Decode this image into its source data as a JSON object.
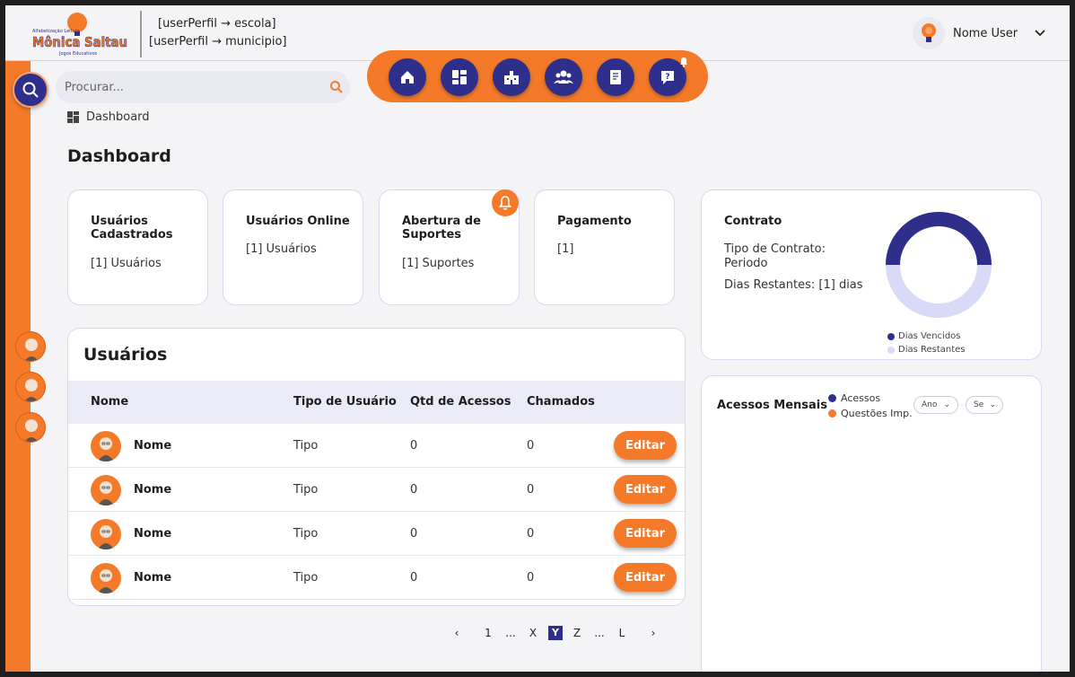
{
  "header": {
    "logo_line1": "Alfabetização Leitura",
    "logo_line2": "Mônica Saltau",
    "logo_line3": "Jogos Educativos",
    "perfil_escola": "[userPerfil → escola]",
    "perfil_municipio": "[userPerfil → municipio]",
    "user_name": "Nome User"
  },
  "search": {
    "placeholder": "Procurar..."
  },
  "nav": {
    "icons": [
      "home-icon",
      "dashboard-icon",
      "school-icon",
      "users-icon",
      "billing-icon",
      "support-icon"
    ]
  },
  "breadcrumb": {
    "label": "Dashboard"
  },
  "page_title": "Dashboard",
  "cards": [
    {
      "title": "Usuários Cadastrados",
      "value": "[1] Usuários"
    },
    {
      "title": "Usuários Online",
      "value": "[1] Usuários"
    },
    {
      "title": "Abertura de Suportes",
      "value": "[1] Suportes"
    },
    {
      "title": "Pagamento",
      "value": "[1]"
    }
  ],
  "contract": {
    "title": "Contrato",
    "type_label": "Tipo de Contrato:",
    "type_value": "Periodo",
    "days_remaining": "Dias Restantes: [1] dias",
    "legend_expired": "Dias Vencidos",
    "legend_remaining": "Dias Restantes",
    "colors": {
      "expired": "#2d2f8a",
      "remaining": "#d9daf7"
    }
  },
  "chart_data": {
    "type": "pie",
    "categories": [
      "Dias Vencidos",
      "Dias Restantes"
    ],
    "values": [
      50,
      50
    ],
    "title": "",
    "legend": "bottom"
  },
  "users": {
    "title": "Usuários",
    "columns": [
      "Nome",
      "Tipo de Usuário",
      "Qtd de Acessos",
      "Chamados"
    ],
    "rows": [
      {
        "name": "Nome",
        "type": "Tipo",
        "access": "0",
        "tickets": "0",
        "action": "Editar"
      },
      {
        "name": "Nome",
        "type": "Tipo",
        "access": "0",
        "tickets": "0",
        "action": "Editar"
      },
      {
        "name": "Nome",
        "type": "Tipo",
        "access": "0",
        "tickets": "0",
        "action": "Editar"
      },
      {
        "name": "Nome",
        "type": "Tipo",
        "access": "0",
        "tickets": "0",
        "action": "Editar"
      }
    ]
  },
  "pagination": {
    "prev": "‹",
    "first": "1",
    "ellipsis1": "...",
    "x": "X",
    "current": "Y",
    "z": "Z",
    "ellipsis2": "...",
    "last": "L",
    "next": "›"
  },
  "access_chart": {
    "title": "Acessos Mensais",
    "legend_access": "Acessos",
    "legend_questions": "Questões Imp.",
    "select_year": "Ano",
    "select_month": "Se",
    "colors": {
      "access": "#2d2f8a",
      "questions": "#f47a2a"
    }
  },
  "theme": {
    "accent": "#f47a2a",
    "primary": "#2d2f8a"
  }
}
